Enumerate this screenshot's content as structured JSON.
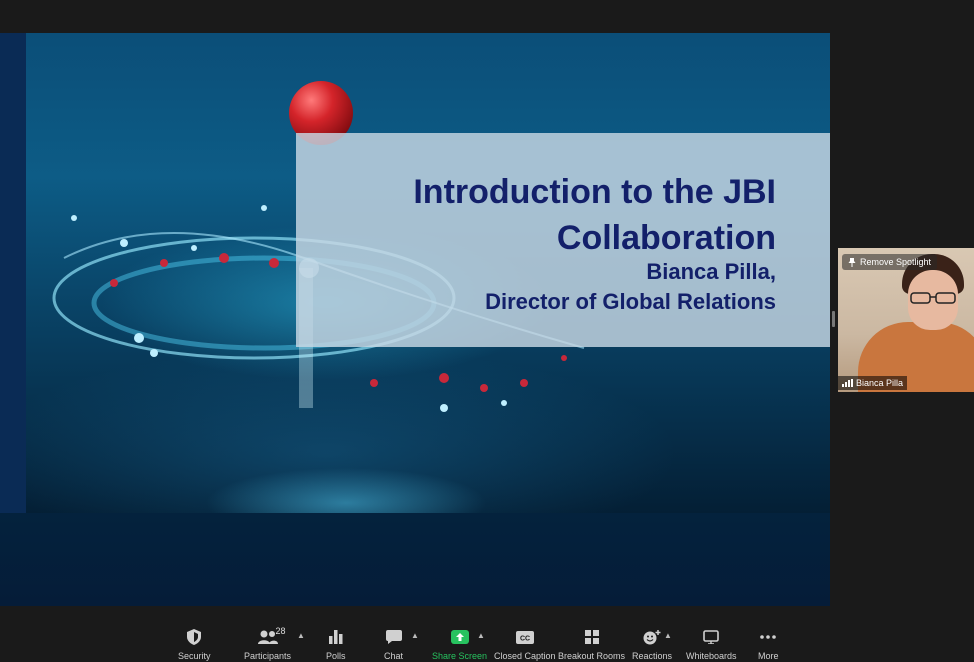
{
  "slide": {
    "title": "Introduction to the JBI Collaboration",
    "presenter_line": "Bianca Pilla,",
    "role_line": "Director of Global Relations"
  },
  "video_tile": {
    "spotlight_label": "Remove Spotlight",
    "participant_name": "Bianca Pilla"
  },
  "toolbar": {
    "items": [
      {
        "label": "Security",
        "icon": "shield-icon"
      },
      {
        "label": "Participants",
        "icon": "people-icon",
        "count": "28"
      },
      {
        "label": "Polls",
        "icon": "bar-chart-icon"
      },
      {
        "label": "Chat",
        "icon": "chat-bubble-icon"
      },
      {
        "label": "Share Screen",
        "icon": "share-screen-icon"
      },
      {
        "label": "Closed Caption",
        "icon": "cc-icon"
      },
      {
        "label": "Breakout Rooms",
        "icon": "grid-icon"
      },
      {
        "label": "Reactions",
        "icon": "smiley-plus-icon"
      },
      {
        "label": "Whiteboards",
        "icon": "whiteboard-icon"
      },
      {
        "label": "More",
        "icon": "ellipsis-icon"
      }
    ]
  },
  "colors": {
    "slide_title": "#13206a",
    "share_screen_active": "#27c25f",
    "toolbar_bg": "#1a1a1a"
  }
}
